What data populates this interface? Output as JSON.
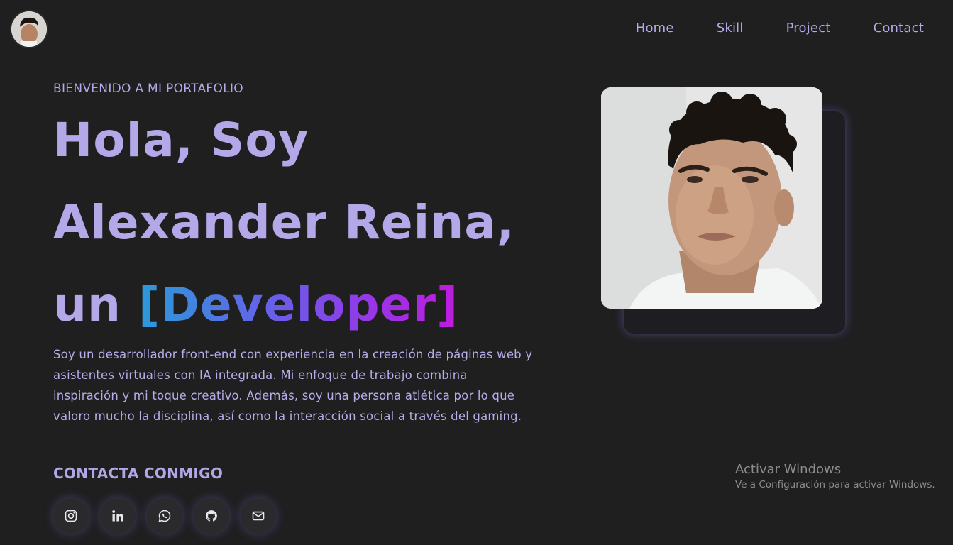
{
  "nav": {
    "items": [
      {
        "label": "Home"
      },
      {
        "label": "Skill"
      },
      {
        "label": "Project"
      },
      {
        "label": "Contact"
      }
    ]
  },
  "hero": {
    "eyebrow": "BIENVENIDO A MI PORTAFOLIO",
    "line1": "Hola, Soy",
    "line2": "Alexander Reina,",
    "line3_prefix": "un",
    "role": "[Developer]",
    "bio": "Soy un desarrollador front-end con experiencia en la creación de páginas web y asistentes virtuales con IA integrada. Mi enfoque de trabajo combina inspiración y mi toque creativo. Además, soy una persona atlética por lo que valoro mucho la disciplina, así como la interacción social a través del gaming."
  },
  "contact": {
    "heading": "CONTACTA CONMIGO",
    "socials": [
      {
        "icon": "instagram-icon"
      },
      {
        "icon": "linkedin-icon"
      },
      {
        "icon": "whatsapp-icon"
      },
      {
        "icon": "github-icon"
      },
      {
        "icon": "mail-icon"
      }
    ]
  },
  "watermark": {
    "title": "Activar Windows",
    "subtitle": "Ve a Configuración para activar Windows."
  },
  "colors": {
    "background": "#1f1f20",
    "accent": "#b5a8e8",
    "gradient_start": "#2a9bd9",
    "gradient_end": "#c01cdc"
  }
}
